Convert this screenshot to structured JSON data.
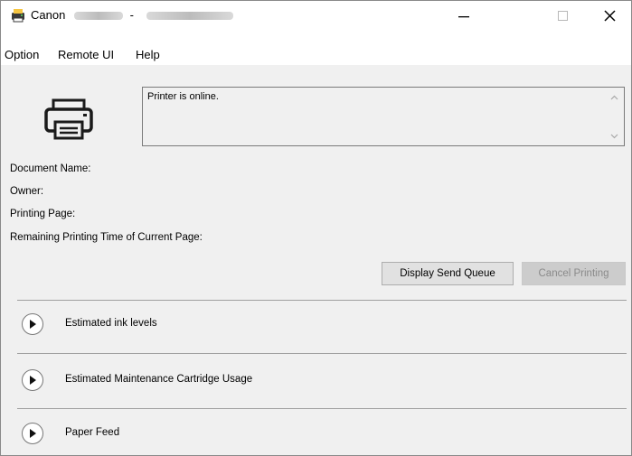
{
  "window": {
    "title_app": "Canon",
    "title_separator": "-",
    "controls": {
      "minimize": "–",
      "maximize": "□",
      "close": "✕"
    }
  },
  "menu": {
    "items": [
      "Option",
      "Remote UI",
      "Help"
    ]
  },
  "status": {
    "message": "Printer is online."
  },
  "info": {
    "document_name": "Document Name:",
    "owner": "Owner:",
    "printing_page": "Printing Page:",
    "remaining_time": "Remaining Printing Time of Current Page:"
  },
  "buttons": {
    "display_send_queue": "Display Send Queue",
    "cancel_printing": "Cancel Printing"
  },
  "sections": [
    {
      "label": "Estimated ink levels"
    },
    {
      "label": "Estimated Maintenance Cartridge Usage"
    },
    {
      "label": "Paper Feed"
    }
  ],
  "icons": {
    "app": "canon-printer-app-icon",
    "printer": "printer-icon",
    "expand": "play-circle-icon"
  }
}
